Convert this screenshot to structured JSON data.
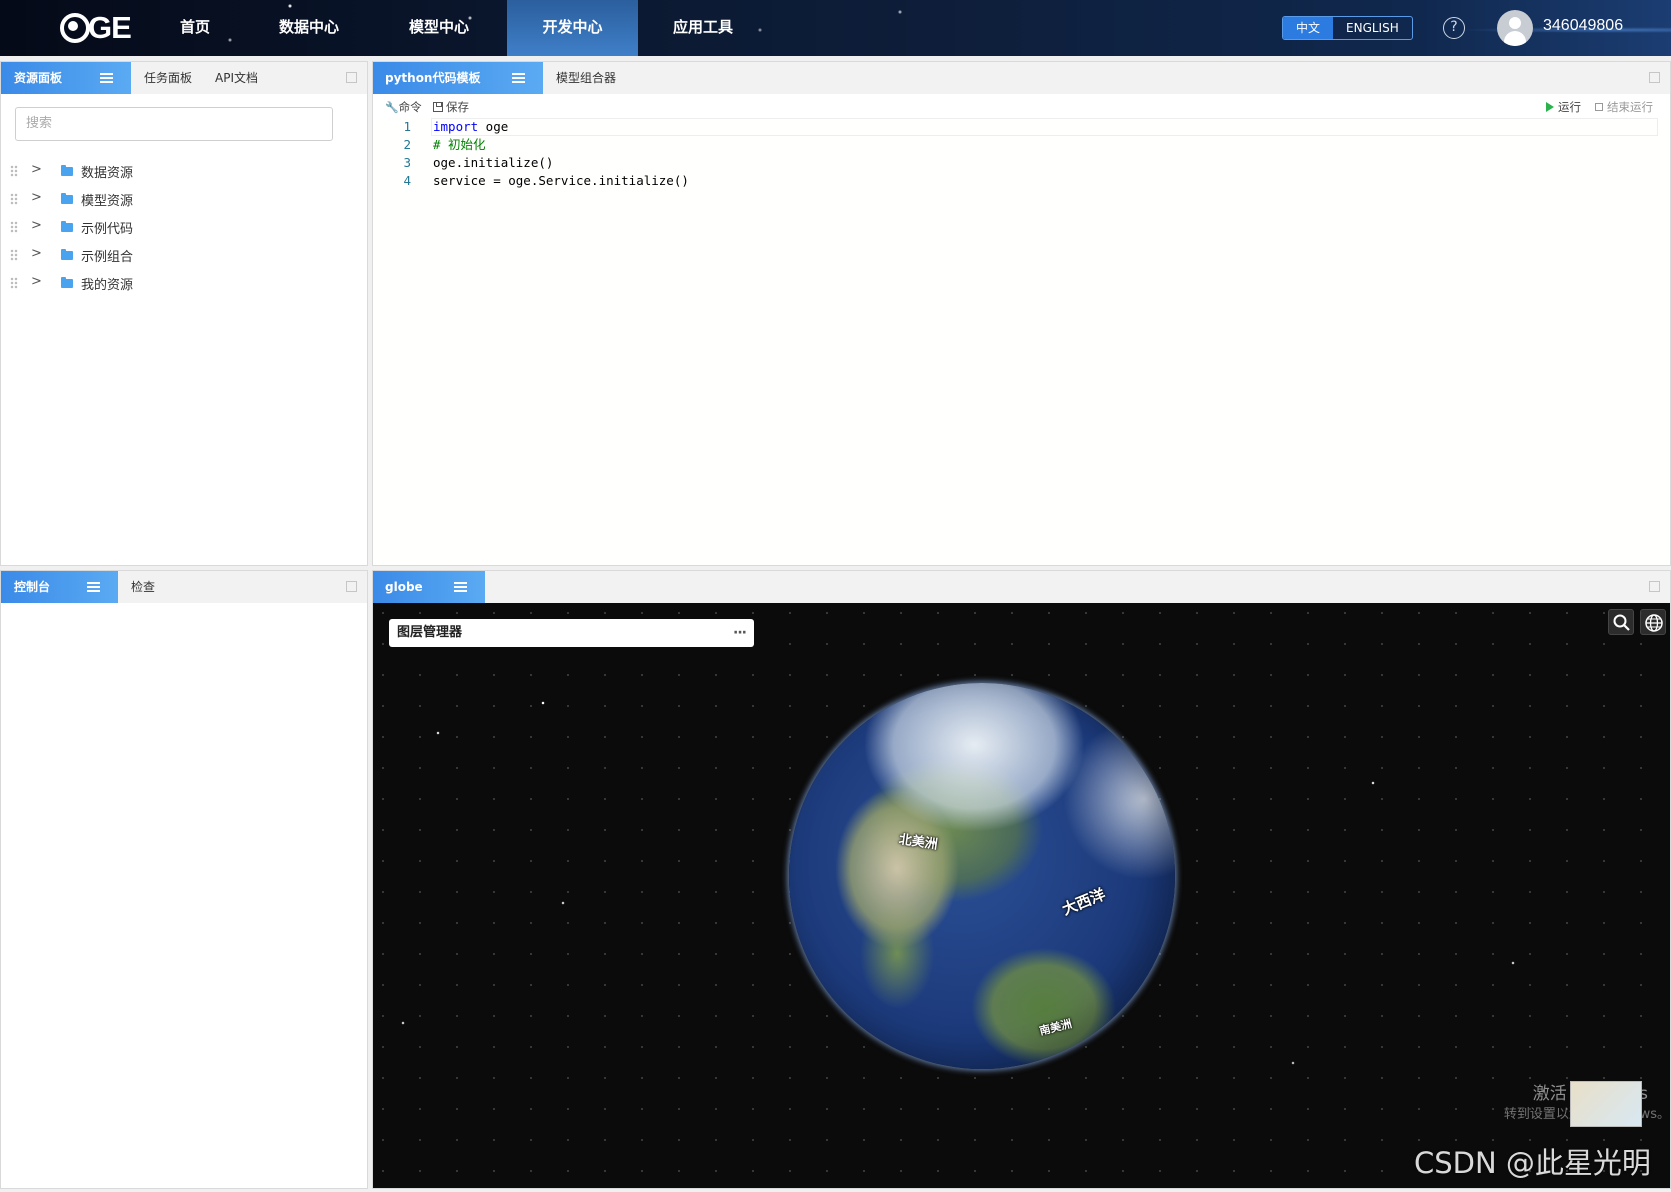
{
  "app": {
    "logo_text": "GE",
    "nav": [
      {
        "label": "首页"
      },
      {
        "label": "数据中心"
      },
      {
        "label": "模型中心"
      },
      {
        "label": "开发中心"
      },
      {
        "label": "应用工具"
      }
    ],
    "active_nav": "开发中心",
    "lang_zh": "中文",
    "lang_en": "ENGLISH",
    "help_glyph": "?",
    "username": "346049806"
  },
  "resource_panel": {
    "tabs": [
      "资源面板",
      "任务面板",
      "API文档"
    ],
    "search_placeholder": "搜索",
    "tree": [
      {
        "label": "数据资源"
      },
      {
        "label": "模型资源"
      },
      {
        "label": "示例代码"
      },
      {
        "label": "示例组合"
      },
      {
        "label": "我的资源"
      }
    ]
  },
  "editor_panel": {
    "tabs": [
      "python代码模板",
      "模型组合器"
    ],
    "toolbar": {
      "command": "命令",
      "save": "保存",
      "run": "运行",
      "stop": "结束运行"
    },
    "lines": [
      {
        "num": "1",
        "keyword": "import",
        "rest": " oge"
      },
      {
        "num": "2",
        "comment": "# 初始化"
      },
      {
        "num": "3",
        "text": "oge.initialize()"
      },
      {
        "num": "4",
        "text": "service = oge.Service.initialize()"
      }
    ]
  },
  "console_panel": {
    "tabs": [
      "控制台",
      "检查"
    ]
  },
  "globe_panel": {
    "tab": "globe",
    "layer_manager": "图层管理器",
    "more": "···",
    "labels": {
      "north_america": "北美洲",
      "atlantic": "大西洋",
      "south_america": "南美洲"
    },
    "watermark_line1": "激活 Windows",
    "watermark_line2": "转到设置以激活 Windows。"
  },
  "credit": "CSDN @此星光明",
  "colors": {
    "accent": "#3a8ae8",
    "nav_active": "#3f7fc8",
    "run_green": "#2bb24c"
  }
}
